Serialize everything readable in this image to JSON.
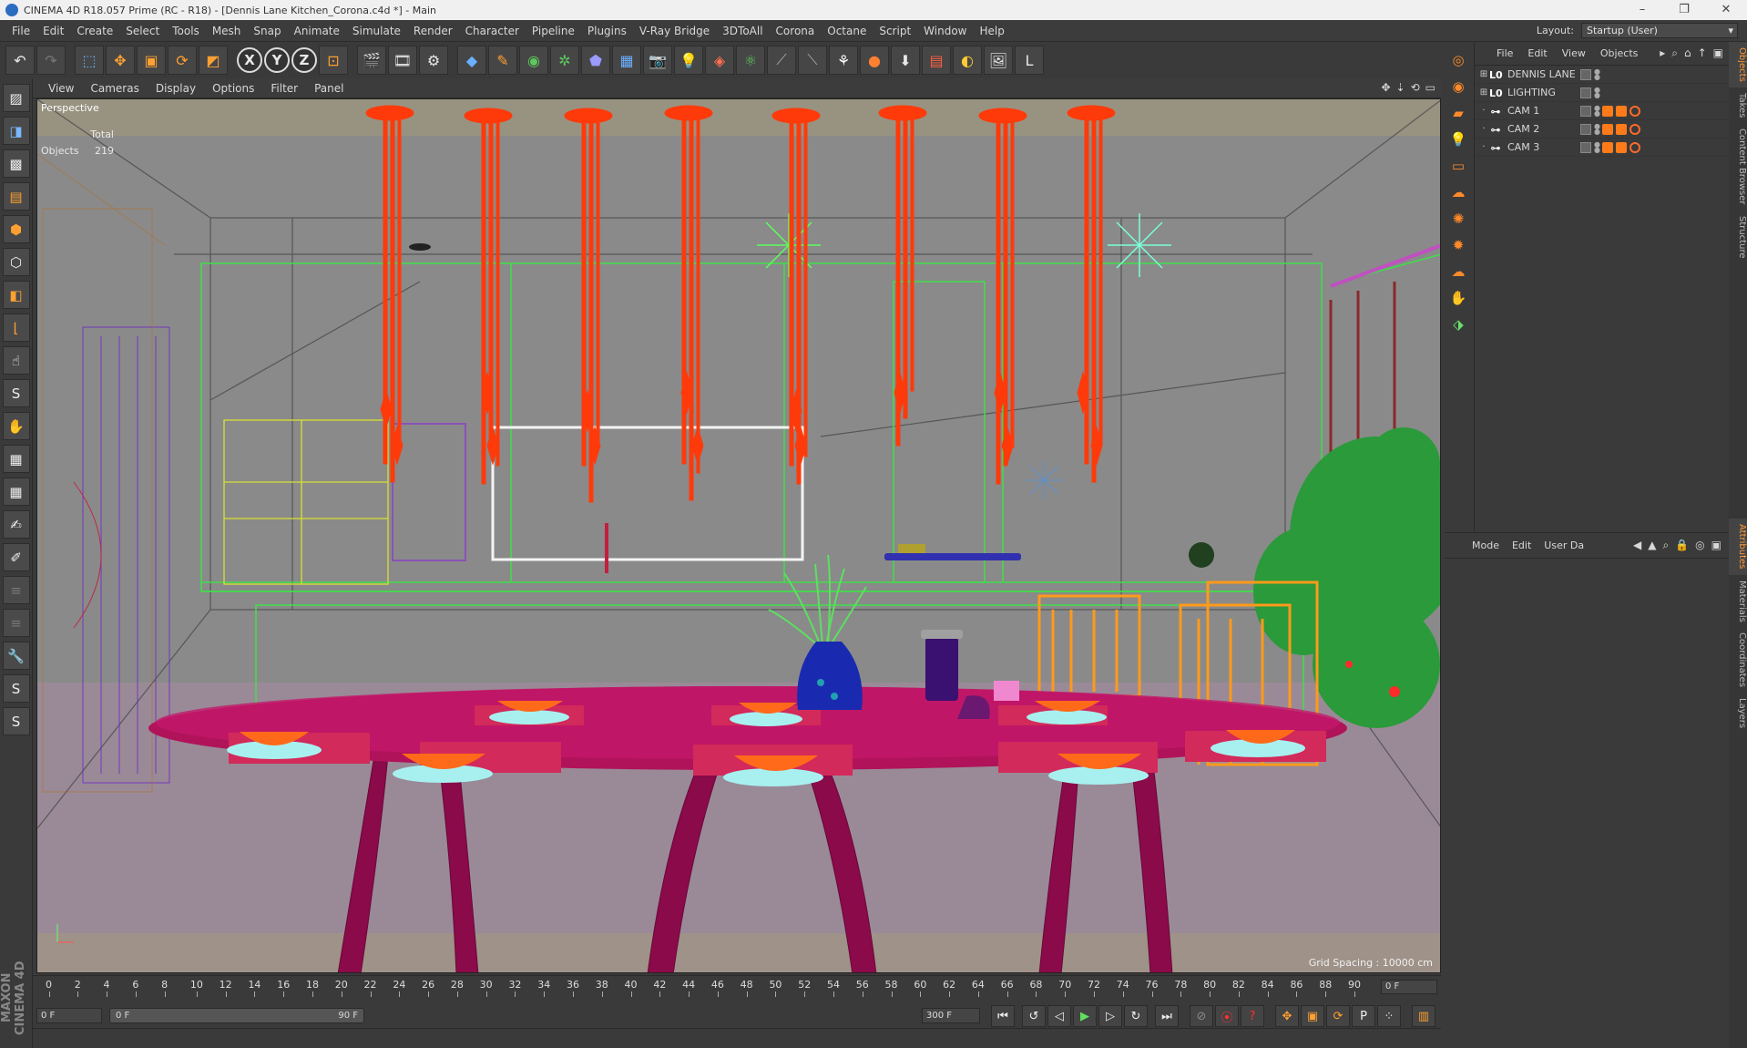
{
  "window": {
    "title": "CINEMA 4D R18.057 Prime (RC - R18) - [Dennis Lane Kitchen_Corona.c4d *] - Main",
    "controls": [
      "–",
      "❐",
      "✕"
    ]
  },
  "menu": [
    "File",
    "Edit",
    "Create",
    "Select",
    "Tools",
    "Mesh",
    "Snap",
    "Animate",
    "Simulate",
    "Render",
    "Character",
    "Pipeline",
    "Plugins",
    "V-Ray Bridge",
    "3DToAll",
    "Corona",
    "Octane",
    "Script",
    "Window",
    "Help"
  ],
  "layout": {
    "label": "Layout:",
    "value": "Startup (User)"
  },
  "toolbar": {
    "axis_x": "X",
    "axis_y": "Y",
    "axis_z": "Z"
  },
  "viewport": {
    "menu": [
      "View",
      "Cameras",
      "Display",
      "Options",
      "Filter",
      "Panel"
    ],
    "name": "Perspective",
    "stats_header": "Total",
    "stats_label": "Objects",
    "stats_value": "219",
    "grid_spacing": "Grid Spacing : 10000 cm"
  },
  "object_manager": {
    "menu": [
      "File",
      "Edit",
      "View",
      "Objects"
    ],
    "rows": [
      {
        "name": "DENNIS LANE",
        "type": "L0"
      },
      {
        "name": "LIGHTING",
        "type": "L0"
      },
      {
        "name": "CAM 1",
        "type": "cam"
      },
      {
        "name": "CAM 2",
        "type": "cam"
      },
      {
        "name": "CAM 3",
        "type": "cam"
      }
    ]
  },
  "attribute_manager": {
    "menu": [
      "Mode",
      "Edit",
      "User Da"
    ]
  },
  "side_tabs_top": [
    "Objects",
    "Takes",
    "Content Browser",
    "Structure"
  ],
  "side_tabs_bottom": [
    "Attributes",
    "Materials",
    "Coordinates",
    "Layers"
  ],
  "timeline": {
    "ticks": [
      "0",
      "2",
      "4",
      "6",
      "8",
      "10",
      "12",
      "14",
      "16",
      "18",
      "20",
      "22",
      "24",
      "26",
      "28",
      "30",
      "32",
      "34",
      "36",
      "38",
      "40",
      "42",
      "44",
      "46",
      "48",
      "50",
      "52",
      "54",
      "56",
      "58",
      "60",
      "62",
      "64",
      "66",
      "68",
      "70",
      "72",
      "74",
      "76",
      "78",
      "80",
      "82",
      "84",
      "86",
      "88",
      "90"
    ],
    "current_frame": "0 F"
  },
  "playback": {
    "start_field": "0 F",
    "range_start": "0 F",
    "range_end": "90 F",
    "end_field": "300 F"
  },
  "brand": "MAXON CINEMA 4D"
}
